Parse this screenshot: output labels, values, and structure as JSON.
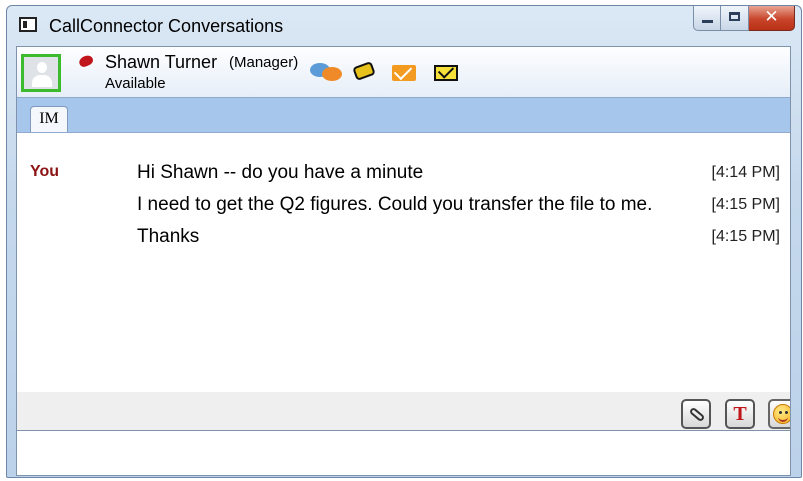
{
  "window": {
    "title": "CallConnector Conversations",
    "close_glyph": "✕"
  },
  "contact": {
    "name": "Shawn Turner",
    "role": "(Manager)",
    "status": "Available",
    "presence_color": "#3dbb2e"
  },
  "actions": {
    "icons": [
      "chat-icon",
      "phone-icon",
      "mail-icon",
      "email-icon"
    ]
  },
  "tabs": [
    {
      "label": "IM",
      "active": true
    }
  ],
  "conversation": {
    "sender": "You",
    "messages": [
      {
        "text": "Hi Shawn -- do you have a minute",
        "time": "[4:14 PM]"
      },
      {
        "text": "I need to get the Q2 figures. Could you transfer the file to me.",
        "time": "[4:15 PM]"
      },
      {
        "text": "Thanks",
        "time": "[4:15 PM]"
      }
    ]
  },
  "toolbar": {
    "font_glyph": "T",
    "buttons": [
      "attach-file-button",
      "font-button",
      "emoticon-button"
    ]
  },
  "input": {
    "value": ""
  },
  "colors": {
    "sender_color": "#8c1313",
    "tab_strip": "#a7c6ec"
  }
}
